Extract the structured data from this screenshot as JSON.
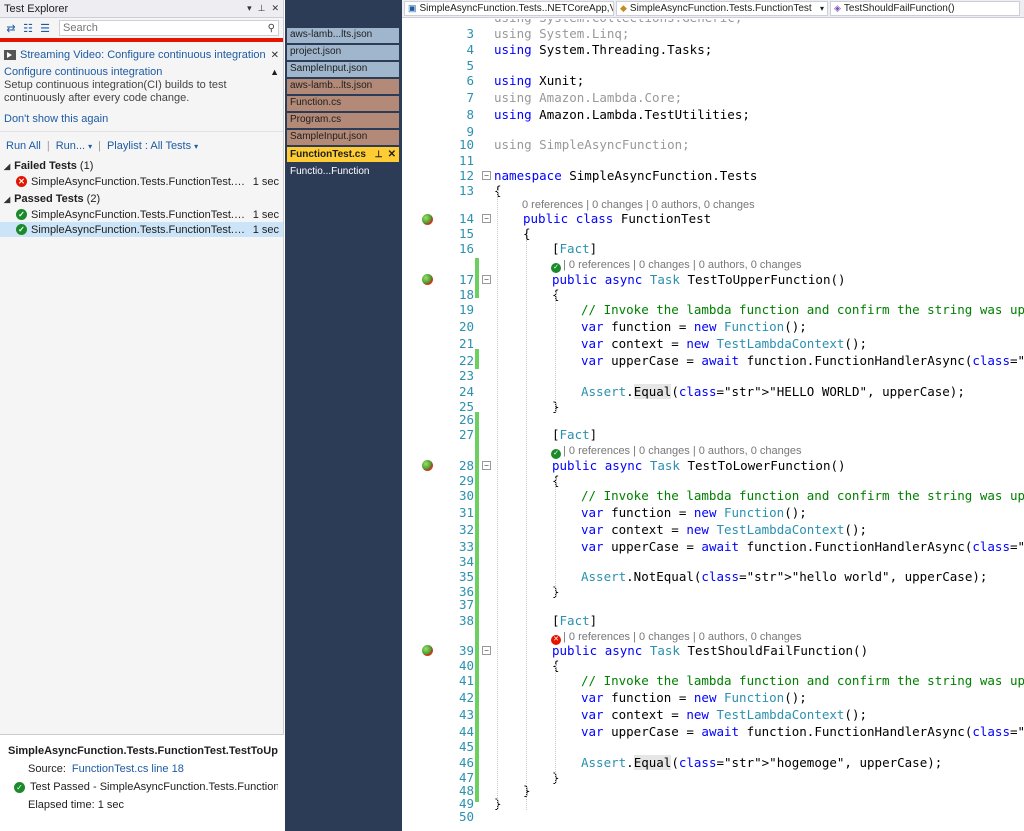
{
  "test_explorer": {
    "title": "Test Explorer",
    "search_placeholder": "Search",
    "streaming_link": "Streaming Video: Configure continuous integration",
    "ci_link": "Configure continuous integration",
    "ci_description": "Setup continuous integration(CI) builds to test continuously after every code change.",
    "dont_show": "Don't show this again",
    "run_all": "Run All",
    "run": "Run...",
    "playlist": "Playlist : All Tests",
    "failed_group": {
      "label": "Failed Tests",
      "count": "(1)"
    },
    "passed_group": {
      "label": "Passed Tests",
      "count": "(2)"
    },
    "failed_tests": [
      {
        "name": "SimpleAsyncFunction.Tests.FunctionTest.TestShouldFail...",
        "duration": "1 sec"
      }
    ],
    "passed_tests": [
      {
        "name": "SimpleAsyncFunction.Tests.FunctionTest.TestToLowerFu...",
        "duration": "1 sec"
      },
      {
        "name": "SimpleAsyncFunction.Tests.FunctionTest.TestToUpperFu...",
        "duration": "1 sec"
      }
    ],
    "detail": {
      "title": "SimpleAsyncFunction.Tests.FunctionTest.TestToUpperFunc",
      "source_label": "Source:",
      "source_link": "FunctionTest.cs line 18",
      "result": "Test Passed - SimpleAsyncFunction.Tests.FunctionTest.TestToUp",
      "elapsed": "Elapsed time: 1 sec"
    }
  },
  "doc_tabs": [
    {
      "label": "aws-lamb...lts.json",
      "style": "blue"
    },
    {
      "label": "project.json",
      "style": "blue"
    },
    {
      "label": "SampleInput.json",
      "style": "blue"
    },
    {
      "label": "aws-lamb...lts.json",
      "style": "brown"
    },
    {
      "label": "Function.cs",
      "style": "brown"
    },
    {
      "label": "Program.cs",
      "style": "brown"
    },
    {
      "label": "SampleInput.json",
      "style": "brown"
    },
    {
      "label": "FunctionTest.cs",
      "style": "active"
    },
    {
      "label": "Functio...Function",
      "style": "plain"
    }
  ],
  "navbar": {
    "project": "SimpleAsyncFunction.Tests..NETCoreApp,Versi",
    "class": "SimpleAsyncFunction.Tests.FunctionTest",
    "member": "TestShouldFailFunction()"
  },
  "code": {
    "line_numbers": [
      "3",
      "4",
      "5",
      "6",
      "7",
      "8",
      "9",
      "10",
      "11",
      "12",
      "13",
      "14",
      "15",
      "16",
      "17",
      "18",
      "19",
      "20",
      "21",
      "22",
      "23",
      "24",
      "25",
      "26",
      "27",
      "28",
      "29",
      "30",
      "31",
      "32",
      "33",
      "34",
      "35",
      "36",
      "37",
      "38",
      "39",
      "40",
      "41",
      "42",
      "43",
      "44",
      "45",
      "46",
      "47",
      "48",
      "49",
      "50"
    ],
    "lens_class": "0 references | 0 changes | 0 authors, 0 changes",
    "lens_test": "| 0 references | 0 changes | 0 authors, 0 changes",
    "top_partial": "using System.Collections.Generic;",
    "l3": "using System.Linq;",
    "l4": "using System.Threading.Tasks;",
    "l6": "using Xunit;",
    "l7": "using Amazon.Lambda.Core;",
    "l8": "using Amazon.Lambda.TestUtilities;",
    "l10": "using SimpleAsyncFunction;",
    "l12": "namespace SimpleAsyncFunction.Tests",
    "brace_open": "{",
    "brace_close": "}",
    "l14": "public class FunctionTest",
    "fact": "[Fact]",
    "l17": "public async Task TestToUpperFunction()",
    "l28": "public async Task TestToLowerFunction()",
    "l39": "public async Task TestShouldFailFunction()",
    "comment_upper": "// Invoke the lambda function and confirm the string was upper casted.",
    "comment_lower": "// Invoke the lambda function and confirm the string was upper casted.",
    "func_line": "var function = new Function();",
    "ctx_line": "var context = new TestLambdaContext();",
    "upper_line": "var upperCase = await function.FunctionHandlerAsync(\"hello world\", context);",
    "assert_upper": "Assert.Equal(\"HELLO WORLD\", upperCase);",
    "assert_lower": "Assert.NotEqual(\"hello world\", upperCase);",
    "assert_fail": "Assert.Equal(\"hogemoge\", upperCase);"
  }
}
